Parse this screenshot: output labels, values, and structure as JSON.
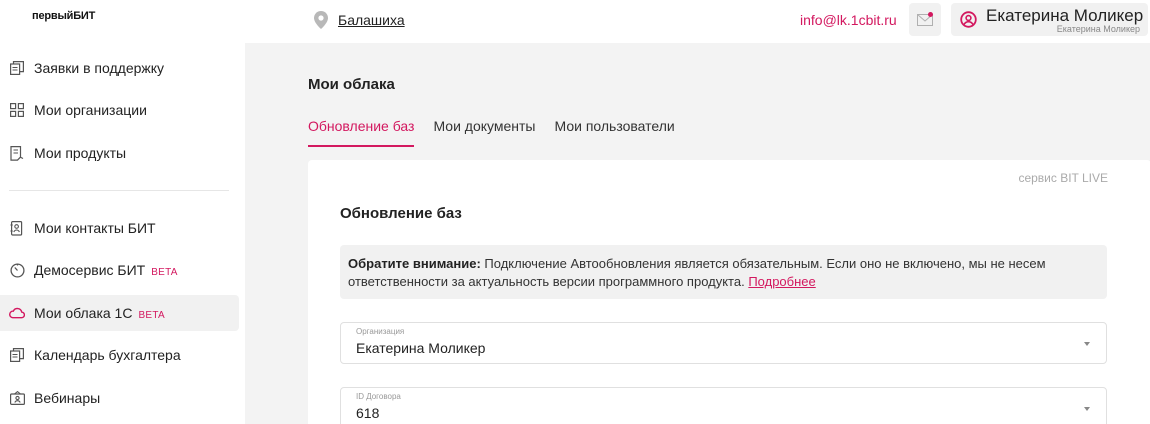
{
  "header": {
    "logo": "первыйБИТ",
    "city": "Балашиха",
    "email": "info@lk.1cbit.ru",
    "user_name": "Екатерина Моликер",
    "user_sub": "Екатерина Моликер"
  },
  "sidebar": {
    "items": [
      {
        "label": "Заявки в поддержку",
        "icon": "documents-icon"
      },
      {
        "label": "Мои организации",
        "icon": "grid-icon"
      },
      {
        "label": "Мои продукты",
        "icon": "product-icon"
      },
      {
        "label": "Мои контакты БИТ",
        "icon": "contacts-icon"
      },
      {
        "label": "Демосервис БИТ",
        "icon": "timer-icon",
        "badge": "BETA"
      },
      {
        "label": "Мои облака 1С",
        "icon": "cloud-icon",
        "badge": "BETA",
        "active": true
      },
      {
        "label": "Календарь бухгалтера",
        "icon": "calendar-icon"
      },
      {
        "label": "Вебинары",
        "icon": "webinar-icon"
      }
    ]
  },
  "main": {
    "title": "Мои облака",
    "tabs": [
      {
        "label": "Обновление баз",
        "active": true
      },
      {
        "label": "Мои документы"
      },
      {
        "label": "Мои пользователи"
      }
    ],
    "card": {
      "service": "сервис BIT LIVE",
      "title": "Обновление баз",
      "notice_bold": "Обратите внимание:",
      "notice_text": " Подключение Автообновления является обязательным. Если оно не включено, мы не несем ответственности за актуальность версии программного продукта. ",
      "notice_link": "Подробнее",
      "fields": [
        {
          "label": "Организация",
          "value": "Екатерина Моликер"
        },
        {
          "label": "ID Договора",
          "value": "618"
        }
      ]
    }
  },
  "colors": {
    "accent": "#d3185f",
    "background": "#f3f3f3",
    "active_item": "#f1f1f1"
  }
}
